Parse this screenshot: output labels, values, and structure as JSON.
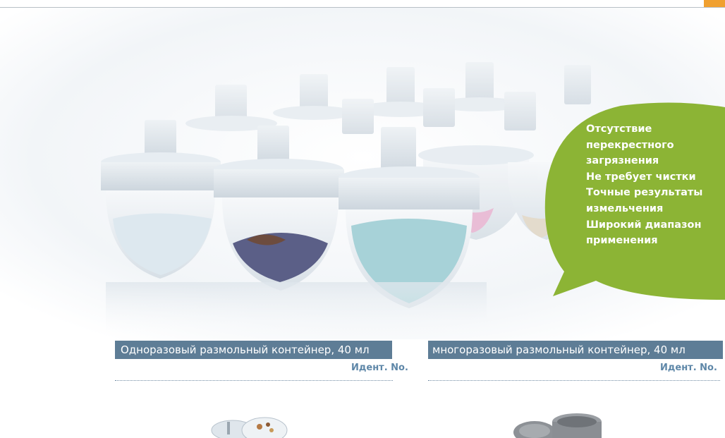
{
  "bubble": {
    "lines": [
      "Отсутствие",
      "перекрестного",
      "загрязнения",
      "Не требует чистки",
      "Точные результаты",
      "измельчения",
      "Широкий диапазон",
      "применения"
    ]
  },
  "left_product": {
    "label": "Одноразовый размольный контейнер, 40 мл",
    "ident": "Идент. No."
  },
  "right_product": {
    "label": "многоразовый размольный контейнер, 40 мл",
    "ident": "Идент. No."
  },
  "colors": {
    "accent_orange": "#f0a030",
    "bubble_green": "#8cb435",
    "label_blue": "#5e7d96",
    "ident_blue": "#5e87a8"
  }
}
